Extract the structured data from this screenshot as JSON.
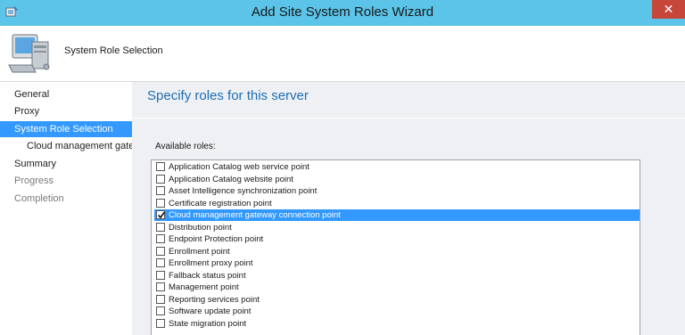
{
  "window": {
    "title": "Add Site System Roles Wizard",
    "close_glyph": "✕",
    "icon": "wizard-icon"
  },
  "header": {
    "page_title": "System Role Selection",
    "icon": "computer-icon"
  },
  "nav": {
    "items": [
      {
        "label": "General",
        "state": "normal"
      },
      {
        "label": "Proxy",
        "state": "normal"
      },
      {
        "label": "System Role Selection",
        "state": "active"
      },
      {
        "label": "Cloud management gateway connection point",
        "state": "sub"
      },
      {
        "label": "Summary",
        "state": "normal"
      },
      {
        "label": "Progress",
        "state": "dim"
      },
      {
        "label": "Completion",
        "state": "dim"
      }
    ]
  },
  "content": {
    "title": "Specify roles for this server",
    "available_label": "Available roles:"
  },
  "roles": [
    {
      "label": "Application Catalog web service point",
      "checked": false,
      "selected": false
    },
    {
      "label": "Application Catalog website point",
      "checked": false,
      "selected": false
    },
    {
      "label": "Asset Intelligence synchronization point",
      "checked": false,
      "selected": false
    },
    {
      "label": "Certificate registration point",
      "checked": false,
      "selected": false
    },
    {
      "label": "Cloud management gateway connection point",
      "checked": true,
      "selected": true
    },
    {
      "label": "Distribution point",
      "checked": false,
      "selected": false
    },
    {
      "label": "Endpoint Protection point",
      "checked": false,
      "selected": false
    },
    {
      "label": "Enrollment point",
      "checked": false,
      "selected": false
    },
    {
      "label": "Enrollment proxy point",
      "checked": false,
      "selected": false
    },
    {
      "label": "Fallback status point",
      "checked": false,
      "selected": false
    },
    {
      "label": "Management point",
      "checked": false,
      "selected": false
    },
    {
      "label": "Reporting services point",
      "checked": false,
      "selected": false
    },
    {
      "label": "Software update point",
      "checked": false,
      "selected": false
    },
    {
      "label": "State migration point",
      "checked": false,
      "selected": false
    }
  ],
  "colors": {
    "titlebar": "#5bc4e8",
    "accent": "#3399ff",
    "close": "#c7463a",
    "heading": "#1e6fb3"
  }
}
